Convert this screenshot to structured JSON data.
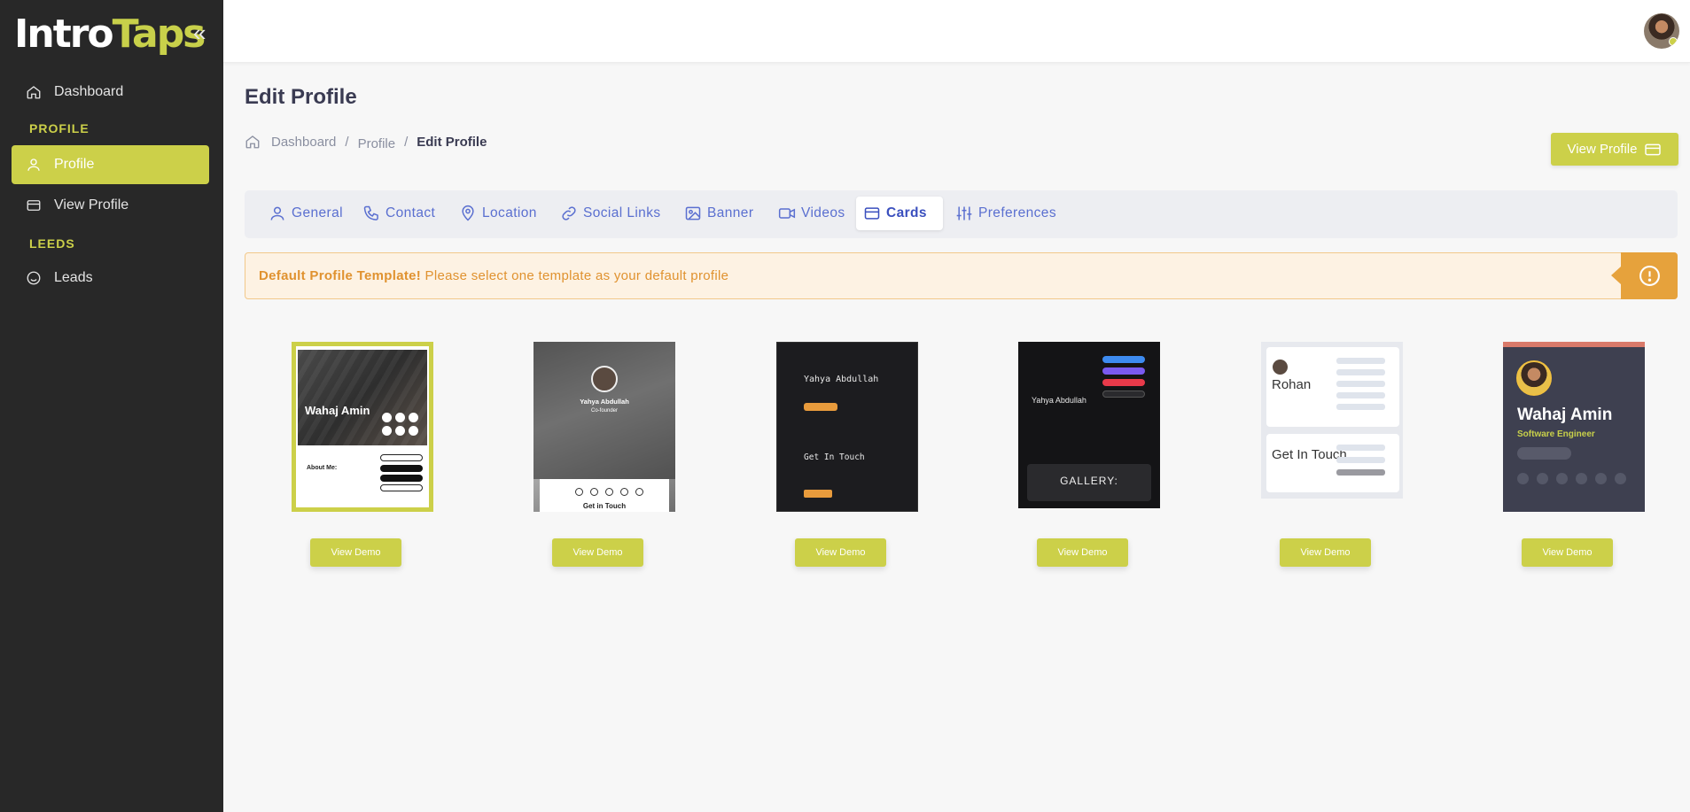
{
  "sidebar": {
    "logo_intro": "Intro",
    "logo_taps": "Taps",
    "collapse_glyph": "«",
    "items": [
      {
        "label": "Dashboard",
        "icon": "home-icon"
      },
      {
        "label": "Profile",
        "icon": "user-icon"
      },
      {
        "label": "View Profile",
        "icon": "card-icon"
      },
      {
        "label": "Leads",
        "icon": "smile-icon"
      }
    ],
    "sections": [
      "PROFILE",
      "LEEDS"
    ]
  },
  "page": {
    "title": "Edit Profile",
    "breadcrumb": [
      "Dashboard",
      "Profile",
      "Edit Profile"
    ],
    "breadcrumb_sep": "/",
    "view_profile_label": "View Profile"
  },
  "tabs": [
    {
      "label": "General",
      "icon": "user-icon"
    },
    {
      "label": "Contact",
      "icon": "phone-icon"
    },
    {
      "label": "Location",
      "icon": "map-pin-icon"
    },
    {
      "label": "Social Links",
      "icon": "link-icon"
    },
    {
      "label": "Banner",
      "icon": "image-icon"
    },
    {
      "label": "Videos",
      "icon": "video-icon"
    },
    {
      "label": "Cards",
      "icon": "card-icon",
      "active": true
    },
    {
      "label": "Preferences",
      "icon": "sliders-icon"
    }
  ],
  "alert": {
    "strong": "Default Profile Template!",
    "message": " Please select one template as your default profile",
    "icon": "alert-circle-icon"
  },
  "templates": [
    {
      "name": "Wahaj Amin",
      "about": "About Me:",
      "selected": true,
      "demo_label": "View Demo"
    },
    {
      "name": "Yahya Abdullah",
      "role": "Co-founder",
      "footer": "Get in Touch",
      "demo_label": "View Demo"
    },
    {
      "name": "Yahya Abdullah",
      "footer": "Get In Touch",
      "demo_label": "View Demo"
    },
    {
      "name": "Yahya Abdullah",
      "footer": "GALLERY:",
      "demo_label": "View Demo"
    },
    {
      "name": "Rohan",
      "footer": "Get In Touch",
      "demo_label": "View Demo"
    },
    {
      "name": "Wahaj Amin",
      "role": "Software Engineer",
      "demo_label": "View Demo"
    }
  ],
  "colors": {
    "accent": "#ccd049",
    "sidebar_bg": "#282828",
    "tab_text": "#5a6fd0",
    "alert_text": "#e0922f",
    "alert_icon_bg": "#e6a23c"
  }
}
